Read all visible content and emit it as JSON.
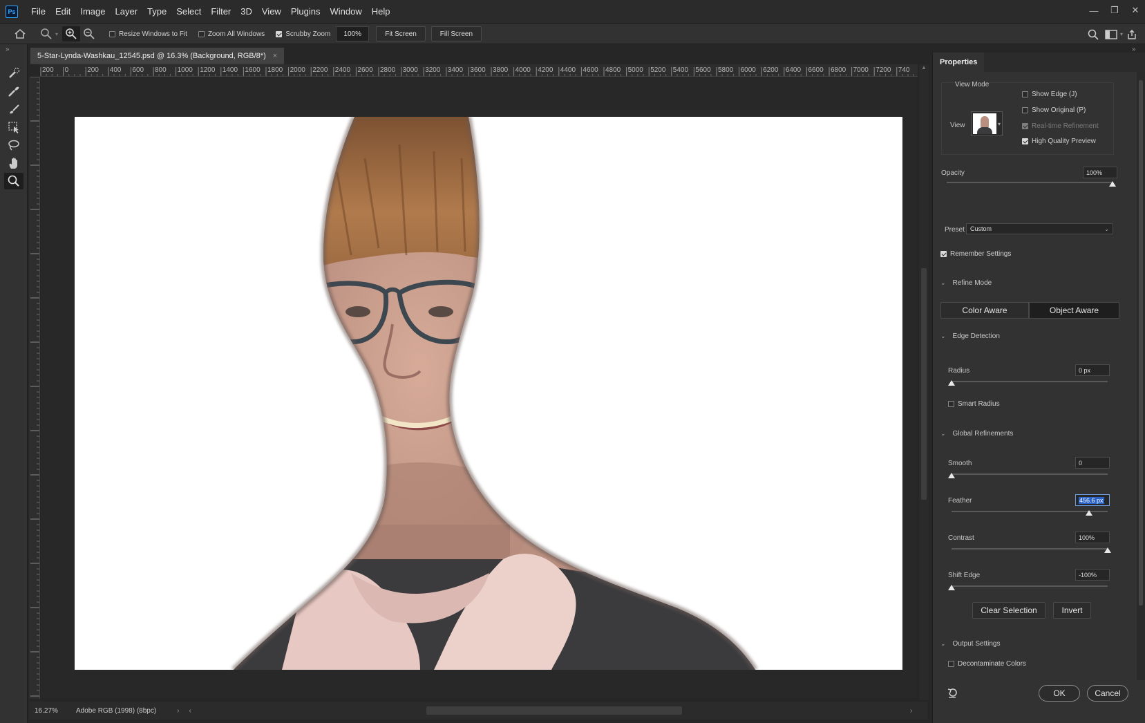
{
  "app": {
    "logo": "Ps"
  },
  "menu": [
    "File",
    "Edit",
    "Image",
    "Layer",
    "Type",
    "Select",
    "Filter",
    "3D",
    "View",
    "Plugins",
    "Window",
    "Help"
  ],
  "options": {
    "resize_windows": "Resize Windows to Fit",
    "zoom_all": "Zoom All Windows",
    "scrubby_zoom": "Scrubby Zoom",
    "zoom_value": "100%",
    "fit_screen": "Fit Screen",
    "fill_screen": "Fill Screen"
  },
  "document": {
    "tab_title": "5-Star-Lynda-Washkau_12545.psd @ 16.3% (Background, RGB/8*)",
    "ruler_top": [
      "200",
      "0",
      "200",
      "400",
      "600",
      "800",
      "1000",
      "1200",
      "1400",
      "1600",
      "1800",
      "2000",
      "2200",
      "2400",
      "2600",
      "2800",
      "3000",
      "3200",
      "3400",
      "3600",
      "3800",
      "4000",
      "4200",
      "4400",
      "4600",
      "4800",
      "5000",
      "5200",
      "5400",
      "5600",
      "5800",
      "6000",
      "6200",
      "6400",
      "6600",
      "6800",
      "7000",
      "7200",
      "740"
    ]
  },
  "status": {
    "zoom": "16.27%",
    "profile": "Adobe RGB (1998) (8bpc)"
  },
  "panel": {
    "title": "Properties",
    "view_mode_title": "View Mode",
    "view_label": "View",
    "show_edge": "Show Edge (J)",
    "show_original": "Show Original (P)",
    "realtime": "Real-time Refinement",
    "hq_preview": "High Quality Preview",
    "opacity_label": "Opacity",
    "opacity_value": "100%",
    "opacity_level": 1.0,
    "preset_label": "Preset",
    "preset_value": "Custom",
    "remember": "Remember Settings",
    "refine_mode": "Refine Mode",
    "color_aware": "Color Aware",
    "object_aware": "Object Aware",
    "edge_detection": "Edge Detection",
    "radius_label": "Radius",
    "radius_value": "0 px",
    "radius_level": 0.0,
    "smart_radius": "Smart Radius",
    "global_refinements": "Global Refinements",
    "smooth_label": "Smooth",
    "smooth_value": "0",
    "smooth_level": 0.0,
    "feather_label": "Feather",
    "feather_value": "456.6 px",
    "feather_level": 0.88,
    "contrast_label": "Contrast",
    "contrast_value": "100%",
    "contrast_level": 1.0,
    "shift_label": "Shift Edge",
    "shift_value": "-100%",
    "shift_level": 0.0,
    "clear_selection": "Clear Selection",
    "invert": "Invert",
    "output_settings": "Output Settings",
    "decontaminate": "Decontaminate Colors",
    "ok": "OK",
    "cancel": "Cancel"
  }
}
